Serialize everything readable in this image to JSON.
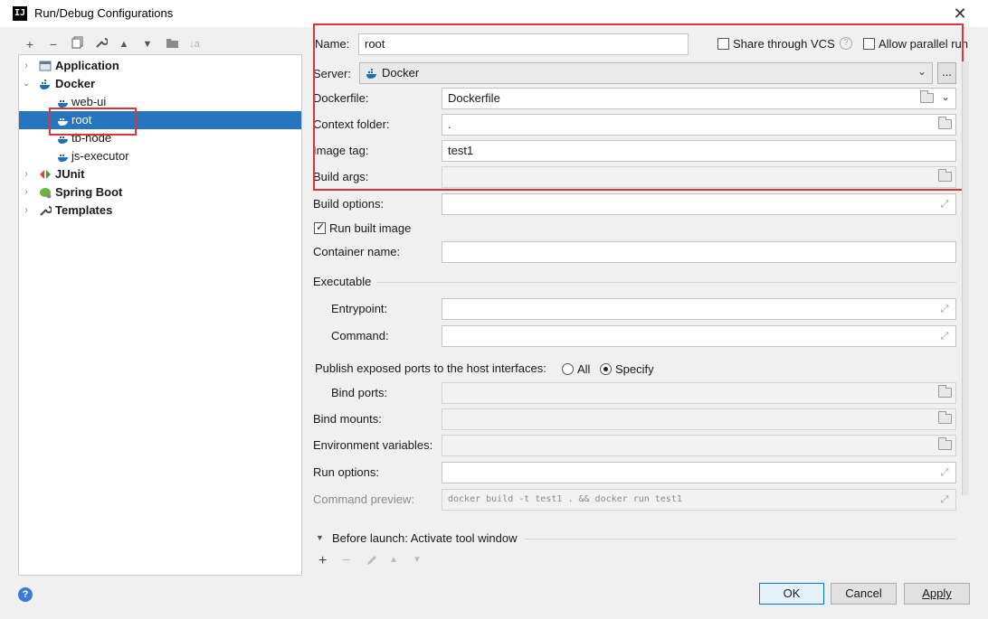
{
  "window": {
    "title": "Run/Debug Configurations",
    "app_icon_text": "IJ"
  },
  "toolbar": {
    "icons": [
      "add-icon",
      "remove-icon",
      "copy-icon",
      "wrench-icon",
      "move-up-icon",
      "move-down-icon",
      "new-folder-icon",
      "sort-icon"
    ],
    "add": "+",
    "remove": "−",
    "up": "▲",
    "down": "▼",
    "sort": "↓a"
  },
  "tree": {
    "items": [
      {
        "label": "Application",
        "bold": true
      },
      {
        "label": "Docker",
        "bold": true
      },
      {
        "label": "web-ui"
      },
      {
        "label": "root",
        "selected": true
      },
      {
        "label": "tb-node"
      },
      {
        "label": "js-executor"
      },
      {
        "label": "JUnit",
        "bold": true
      },
      {
        "label": "Spring Boot",
        "bold": true
      },
      {
        "label": "Templates",
        "bold": true
      }
    ]
  },
  "form": {
    "name_label": "Name:",
    "name_value": "root",
    "share_vcs_label": "Share through VCS",
    "allow_parallel_label": "Allow parallel run",
    "server_label": "Server:",
    "server_value": "Docker",
    "more_button": "...",
    "dockerfile_label": "Dockerfile:",
    "dockerfile_value": "Dockerfile",
    "context_label": "Context folder:",
    "context_value": ".",
    "image_tag_label": "Image tag:",
    "image_tag_value": "test1",
    "build_args_label": "Build args:",
    "build_options_label": "Build options:",
    "run_built_image_label": "Run built image",
    "container_name_label": "Container name:",
    "executable_label": "Executable",
    "entrypoint_label": "Entrypoint:",
    "command_label": "Command:",
    "publish_label": "Publish exposed ports to the host interfaces:",
    "radio_all": "All",
    "radio_specify": "Specify",
    "bind_ports_label": "Bind ports:",
    "bind_mounts_label": "Bind mounts:",
    "env_vars_label": "Environment variables:",
    "run_options_label": "Run options:",
    "command_preview_label": "Command preview:",
    "command_preview_value": "docker build -t test1 . && docker run test1",
    "before_launch_label": "Before launch: Activate tool window"
  },
  "buttons": {
    "ok": "OK",
    "cancel": "Cancel",
    "apply": "Apply",
    "help": "?"
  },
  "colors": {
    "selection": "#2675bf",
    "annotation": "#e0333a",
    "docker": "#1f6fb5"
  }
}
